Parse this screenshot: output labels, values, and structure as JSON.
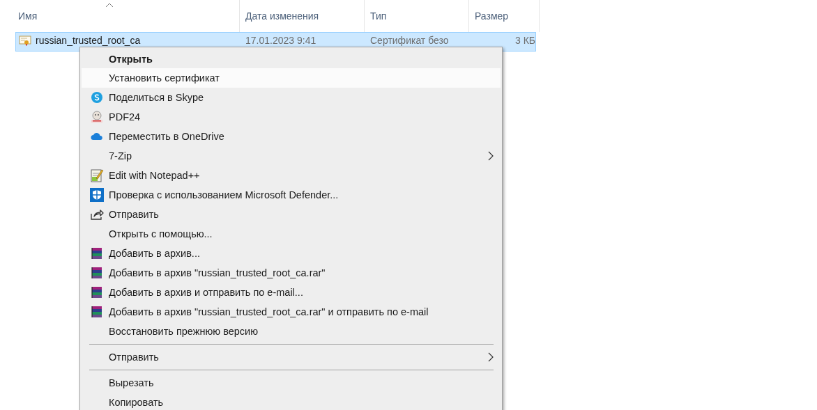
{
  "columns": [
    {
      "label": "Имя",
      "sorted": true
    },
    {
      "label": "Дата изменения",
      "sorted": false
    },
    {
      "label": "Тип",
      "sorted": false
    },
    {
      "label": "Размер",
      "sorted": false
    }
  ],
  "file": {
    "name": "russian_trusted_root_ca",
    "date": "17.01.2023 9:41",
    "type": "Сертификат безо",
    "size": "3 КБ",
    "selected": true
  },
  "menu": [
    {
      "kind": "plain",
      "label": "Открыть",
      "bold": true,
      "selected": false
    },
    {
      "kind": "plain",
      "label": "Установить сертификат",
      "selected": true
    },
    {
      "kind": "skype",
      "label": "Поделиться в Skype",
      "selected": false
    },
    {
      "kind": "pdf",
      "label": "PDF24",
      "selected": false
    },
    {
      "kind": "cloud",
      "label": "Переместить в OneDrive",
      "selected": false
    },
    {
      "kind": "plain",
      "label": "7-Zip",
      "submenu": true,
      "selected": false
    },
    {
      "kind": "notepad",
      "label": "Edit with Notepad++",
      "selected": false
    },
    {
      "kind": "shield",
      "label": "Проверка с использованием Microsoft Defender...",
      "selected": false
    },
    {
      "kind": "share",
      "label": "Отправить",
      "selected": false
    },
    {
      "kind": "plain",
      "label": "Открыть с помощью...",
      "selected": false
    },
    {
      "kind": "archive",
      "label": "Добавить в архив...",
      "selected": false
    },
    {
      "kind": "archive",
      "label": "Добавить в архив \"russian_trusted_root_ca.rar\"",
      "selected": false
    },
    {
      "kind": "archive",
      "label": "Добавить в архив и отправить по e-mail...",
      "selected": false
    },
    {
      "kind": "archive",
      "label": "Добавить в архив \"russian_trusted_root_ca.rar\" и отправить по e-mail",
      "selected": false
    },
    {
      "kind": "plain",
      "label": "Восстановить прежнюю версию",
      "selected": false
    },
    {
      "kind": "separator"
    },
    {
      "kind": "plain",
      "label": "Отправить",
      "submenu": true,
      "selected": false
    },
    {
      "kind": "separator"
    },
    {
      "kind": "plain",
      "label": "Вырезать",
      "selected": false
    },
    {
      "kind": "plain",
      "label": "Копировать",
      "selected": false
    }
  ]
}
